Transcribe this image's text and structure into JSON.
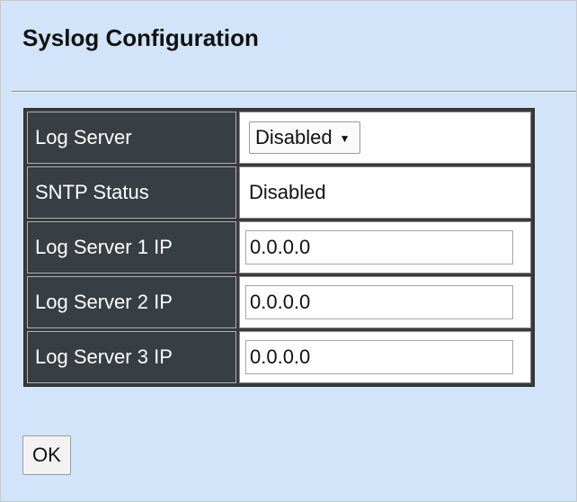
{
  "page": {
    "title": "Syslog Configuration"
  },
  "form": {
    "log_server": {
      "label": "Log Server",
      "selected": "Disabled",
      "arrow": "▼"
    },
    "sntp_status": {
      "label": "SNTP Status",
      "value": "Disabled"
    },
    "log_server_1_ip": {
      "label": "Log Server 1 IP",
      "value": "0.0.0.0"
    },
    "log_server_2_ip": {
      "label": "Log Server 2 IP",
      "value": "0.0.0.0"
    },
    "log_server_3_ip": {
      "label": "Log Server 3 IP",
      "value": "0.0.0.0"
    }
  },
  "actions": {
    "ok_label": "OK"
  },
  "colors": {
    "page_background": "#d1e4f9",
    "label_cell_background": "#373e44",
    "label_text": "#ffffff",
    "table_border": "#3a3a3a",
    "value_cell_background": "#ffffff"
  }
}
